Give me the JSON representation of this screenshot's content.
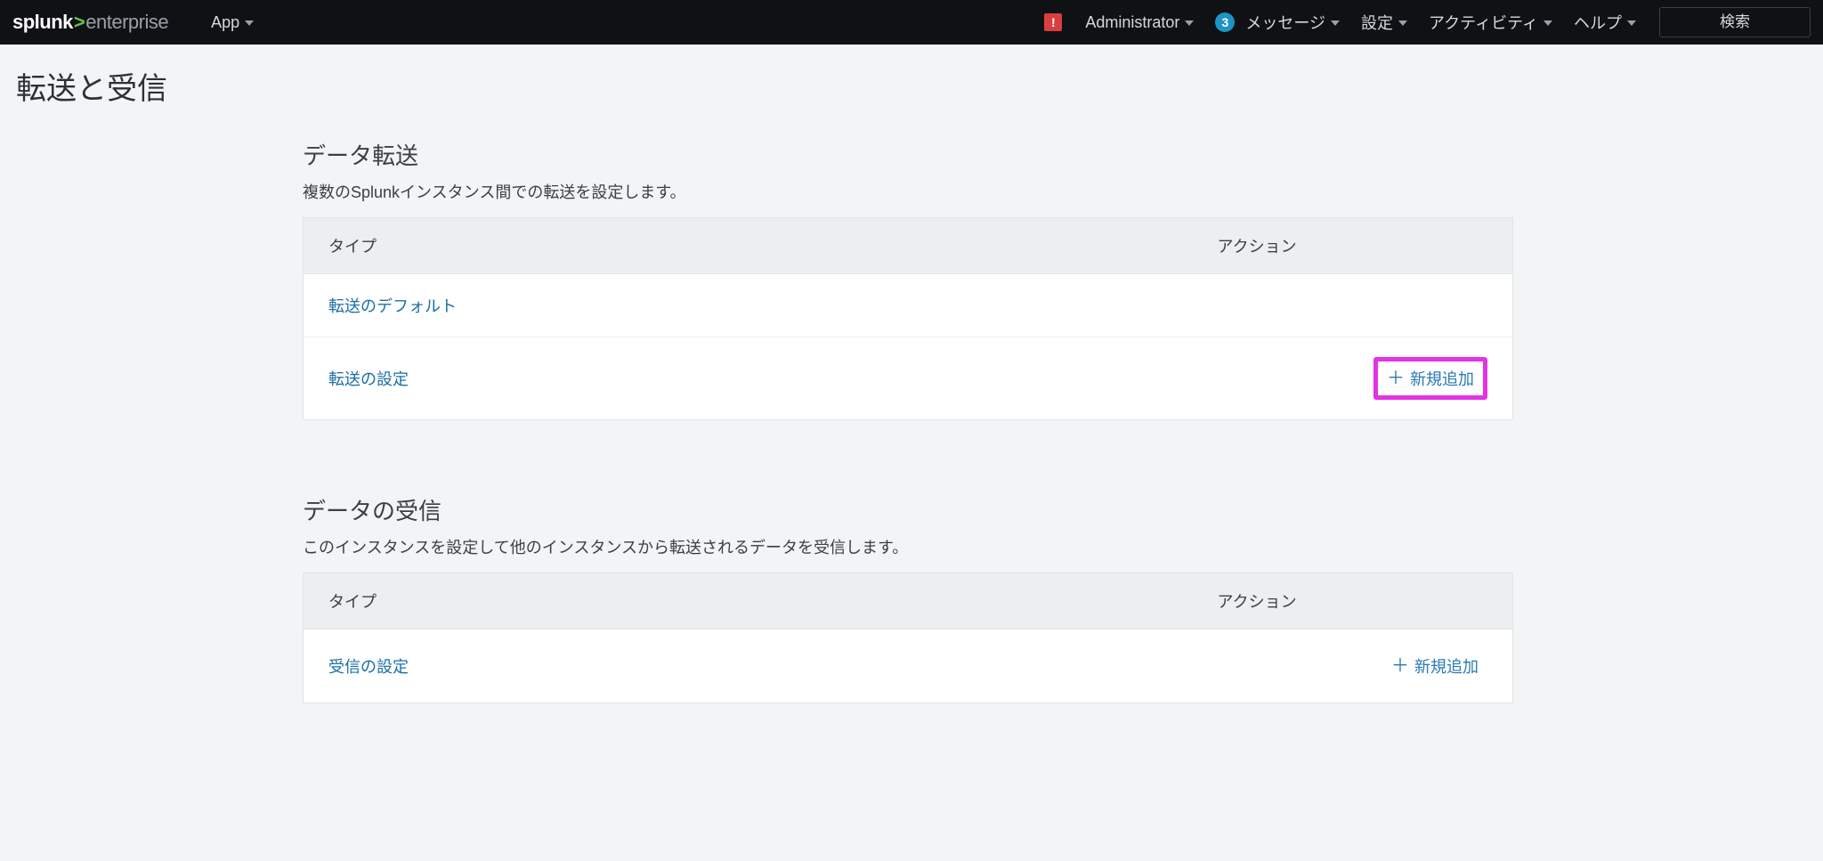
{
  "brand": {
    "part1": "splunk",
    "gt": ">",
    "part2": "enterprise"
  },
  "nav": {
    "app": "App",
    "alert_glyph": "!",
    "admin": "Administrator",
    "messages_badge": "3",
    "messages": "メッセージ",
    "settings": "設定",
    "activity": "アクティビティ",
    "help": "ヘルプ",
    "search_placeholder": "検索"
  },
  "page": {
    "title": "転送と受信"
  },
  "forwarding": {
    "title": "データ転送",
    "desc": "複数のSplunkインスタンス間での転送を設定します。",
    "col_type": "タイプ",
    "col_action": "アクション",
    "rows": [
      {
        "label": "転送のデフォルト",
        "add": null,
        "highlight": false
      },
      {
        "label": "転送の設定",
        "add": "新規追加",
        "highlight": true
      }
    ]
  },
  "receiving": {
    "title": "データの受信",
    "desc": "このインスタンスを設定して他のインスタンスから転送されるデータを受信します。",
    "col_type": "タイプ",
    "col_action": "アクション",
    "rows": [
      {
        "label": "受信の設定",
        "add": "新規追加",
        "highlight": false
      }
    ]
  },
  "glyph": {
    "plus": "＋"
  }
}
